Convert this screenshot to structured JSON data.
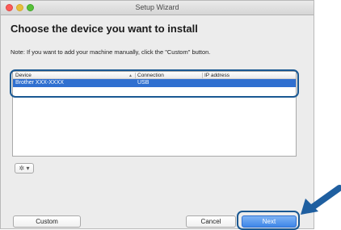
{
  "window": {
    "title": "Setup Wizard"
  },
  "heading": "Choose the device you want to install",
  "note": "Note: If you want to add your machine manually, click the \"Custom\" button.",
  "table": {
    "columns": [
      "Device",
      "Connection",
      "IP address"
    ],
    "rows": [
      {
        "device": "Brother XXX-XXXX",
        "connection": "USB",
        "ip": ""
      }
    ]
  },
  "gear_button": {
    "icon": "gear-icon",
    "label": "✲ ▾"
  },
  "buttons": {
    "custom": "Custom",
    "cancel": "Cancel",
    "next": "Next"
  },
  "colors": {
    "highlight": "#1a5892",
    "selection": "#2f6fd0",
    "arrow": "#1f5fa0"
  }
}
